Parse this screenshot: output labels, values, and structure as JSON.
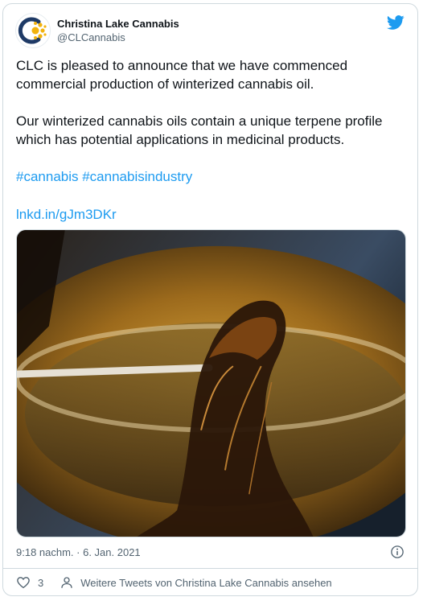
{
  "author": {
    "display_name": "Christina Lake Cannabis",
    "handle": "@CLCannabis"
  },
  "tweet": {
    "paragraph_1": "CLC is pleased to announce that we have commenced commercial production of winterized cannabis oil.",
    "paragraph_2": "Our winterized cannabis oils contain a unique terpene profile which has potential applications in medicinal products.",
    "hashtags": "#cannabis #cannabisindustry",
    "link": "lnkd.in/gJm3DKr"
  },
  "timestamp": "9:18 nachm. · 6. Jan. 2021",
  "actions": {
    "like_count": "3",
    "more_tweets_label": "Weitere Tweets von Christina Lake Cannabis ansehen"
  },
  "colors": {
    "link": "#1d9bf0",
    "twitter_blue": "#1d9bf0",
    "secondary_text": "#536471"
  },
  "icons": [
    "twitter-bird-icon",
    "info-icon",
    "heart-icon",
    "person-icon"
  ]
}
